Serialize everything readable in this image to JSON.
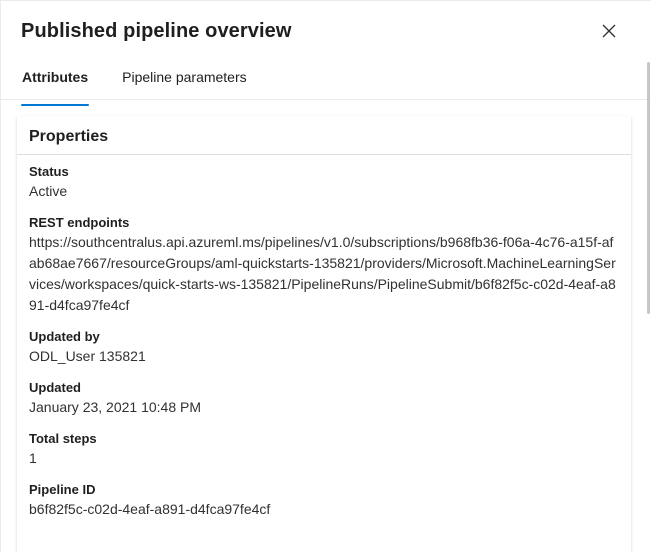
{
  "panel": {
    "title": "Published pipeline overview",
    "close_icon": "close-icon"
  },
  "tabs": [
    {
      "label": "Attributes",
      "active": true
    },
    {
      "label": "Pipeline parameters",
      "active": false
    }
  ],
  "colors": {
    "accent": "#0078d4",
    "text": "#323130",
    "heading": "#201f1e",
    "divider": "#edebe9"
  },
  "card": {
    "title": "Properties",
    "properties": [
      {
        "label": "Status",
        "value": "Active"
      },
      {
        "label": "REST endpoints",
        "value": "https://southcentralus.api.azureml.ms/pipelines/v1.0/subscriptions/b968fb36-f06a-4c76-a15f-afab68ae7667/resourceGroups/aml-quickstarts-135821/providers/Microsoft.MachineLearningServices/workspaces/quick-starts-ws-135821/PipelineRuns/PipelineSubmit/b6f82f5c-c02d-4eaf-a891-d4fca97fe4cf"
      },
      {
        "label": "Updated by",
        "value": "ODL_User 135821"
      },
      {
        "label": "Updated",
        "value": "January 23, 2021 10:48 PM"
      },
      {
        "label": "Total steps",
        "value": "1"
      },
      {
        "label": "Pipeline ID",
        "value": "b6f82f5c-c02d-4eaf-a891-d4fca97fe4cf"
      }
    ]
  }
}
